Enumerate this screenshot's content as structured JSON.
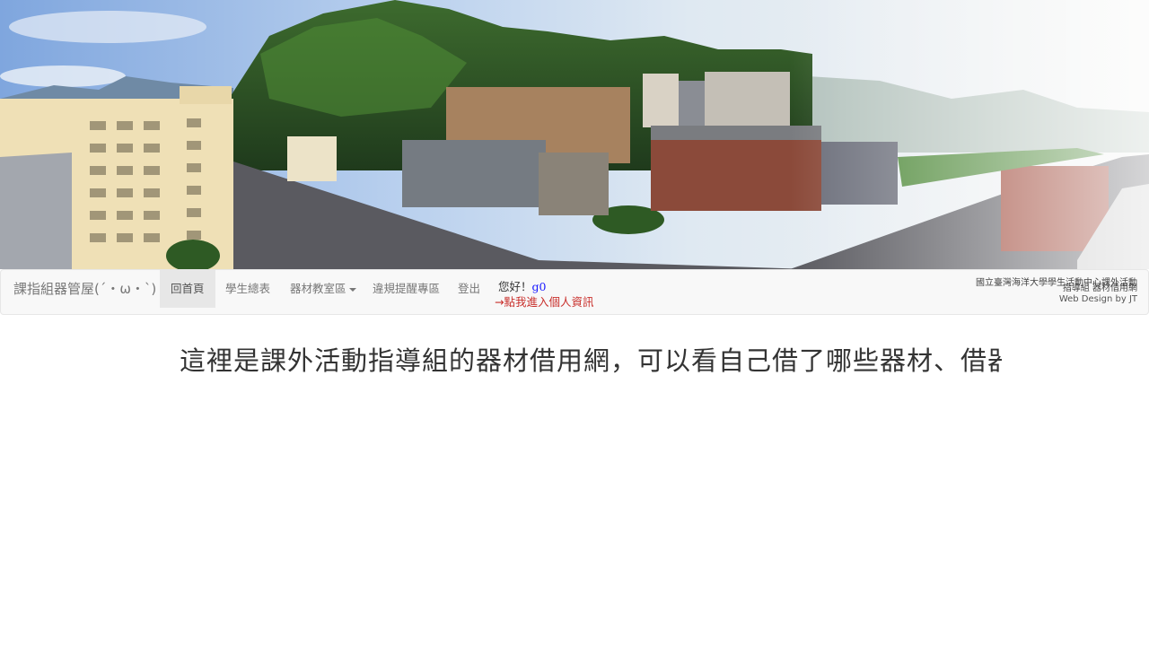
{
  "banner": {
    "alt": "campus panorama",
    "colors": {
      "sky": "#a9c6ec",
      "mountain": "#2f5a28",
      "buildings": "#8a6a52",
      "road": "#4a4a52"
    }
  },
  "navbar": {
    "brand": "課指組器管屋(´・ω・`)",
    "items": [
      {
        "label": "回首頁",
        "active": true
      },
      {
        "label": "學生總表"
      },
      {
        "label": "器材教室區",
        "dropdown": true
      },
      {
        "label": "違規提醒專區"
      },
      {
        "label": "登出"
      }
    ],
    "greeting": {
      "prefix": "您好！",
      "username": "g0"
    },
    "profile_link": "→點我進入個人資訊",
    "credits": {
      "org_line_1": "國立臺灣海洋大學學生活動中心課外活動",
      "org_line_2": "指導組 器材借用網",
      "design": "Web Design by JT"
    }
  },
  "main": {
    "marquee": "這裡是課外活動指導組的器材借用網，可以看自己借了哪些器材、借器材"
  }
}
